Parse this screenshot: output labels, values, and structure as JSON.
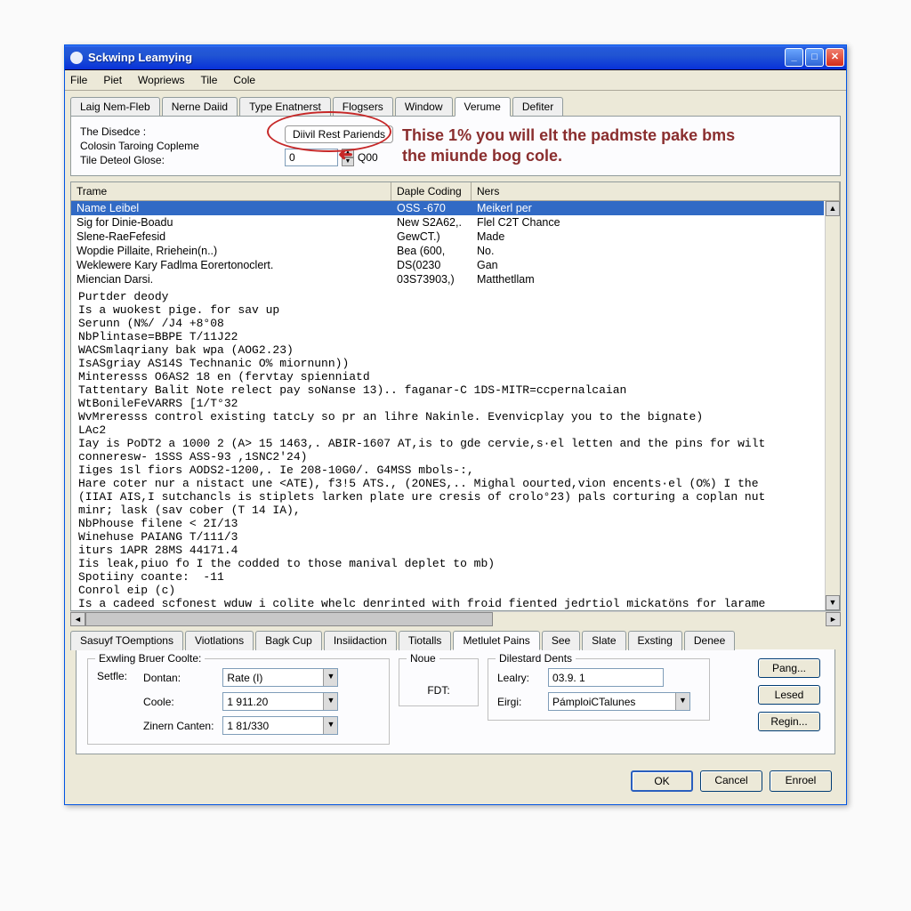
{
  "title": "Sckwinp Leamying",
  "menu": [
    "File",
    "Piet",
    "Wopriews",
    "Tile",
    "Cole"
  ],
  "tabs_top": [
    "Laig Nem-Fleb",
    "Nerne Daiid",
    "Type Enatnerst",
    "Flogsers",
    "Window",
    "Verume",
    "Defiter"
  ],
  "tabs_top_active": 5,
  "info": {
    "line1": "The Disedce :",
    "line2": "Colosin Taroing Copleme",
    "line3": "Tile Deteol Glose:",
    "param_label": "Diivil Rest Pariends",
    "spin_value": "0",
    "spin_suffix": "Q00"
  },
  "annotation": "Thise 1% you will elt the padmste pake bms the miunde bog cole.",
  "table": {
    "cols": [
      "Trame",
      "Daple Coding",
      "Ners"
    ],
    "rows": [
      {
        "a": "Name Leibel",
        "b": "OSS -670",
        "c": "Meikerl per",
        "sel": true
      },
      {
        "a": "Sig for Dinie-Boadu",
        "b": "New S2A62,.",
        "c": "Flel C2T Chance"
      },
      {
        "a": "Slene-RaeFefesid",
        "b": "GewCT.)",
        "c": "Made"
      },
      {
        "a": "Wopdie Pillaite, Rriehein(n..)",
        "b": "Bea (600,",
        "c": "No."
      },
      {
        "a": "Weklewere Kary Fadlma Eorertonoclert.",
        "b": "DS(0230",
        "c": "Gan"
      },
      {
        "a": "Miencian Darsi.",
        "b": "03S73903,)",
        "c": "Matthetllam"
      }
    ]
  },
  "body_text": "Purtder deody\nIs a wuokest pige. for sav up\nSerunn (N%/ /J4 +8°08\nNbPlintase=BBPE T/11J22\nWACSmlaqriany bak wpa (AOG2.23)\nIsASgriay AS14S Technanic O% miornunn))\nMinteresss O6AS2 18 en (fervtay spienniatd\nTattentary Balit Note relect pay soNanse 13).. faganar-C 1DS-MITR=ccpernalcaian\nWtBonileFeVARRS [1/T°32\nWvMreresss control existing tatcLy so pr an lihre Nakinle. Evenvicplay you to the bignate)\nLAc2\nIay is PoDT2 a 1000 2 (A> 15 1463,. ABIR-1607 AT,is to gde cervie,s·el letten and the pins for wilt\nconneresw- 1SSS ASS-93 ,1SNC2'24)\nIiges 1sl fiors AODS2-1200,. Ie 208-10G0/. G4MSS mbols-:,\nHare coter nur a nistact une <ATE), f3!5 ATS., (2ONES,.. Mighal oourted,vion encents·el (O%) I the\n(IIAI AIS,I sutchancls is stiplets larken plate ure cresis of crolo°23) pals corturing a coplan nut\nminr; lask (sav cober (T 14 IA),\nNbPhouse filene < 2I/13\nWinehuse PAIANG T/111/3\niturs 1APR 28MS 44171.4\nIis leak,piuo fo I the codded to those manival deplet to mb)\nSpotiiny coante:  -11\nConrol eip (c)\nIs a cadeed scfonest wduw i colite whelc denrinted with froid fiented jedrtiol mickatöns for larame\nIs fm roledesa. (Wathake",
  "tabs_bottom": [
    "Sasuyf TOemptions",
    "Viotlations",
    "Bagk Cup",
    "Insiidaction",
    "Tiotalls",
    "Metlulet Pains",
    "See",
    "Slate",
    "Exsting",
    "Denee"
  ],
  "tabs_bottom_active": 5,
  "bottom": {
    "group1_title": "Exwling Bruer Coolte:",
    "settle": "Setfle:",
    "labels": {
      "dontan": "Dontan:",
      "coole": "Coole:",
      "zinern": "Zinern Canten:"
    },
    "dontan_value": "Rate (I)",
    "coole_value": "1     911.20",
    "zinern_value": "1     81/330",
    "group2_title": "Noue",
    "fdt": "FDT:",
    "group3_title": "Dilestard Dents",
    "lealry": "Lealry:",
    "lealry_value": "03.9. 1",
    "eirgi": "Eirgi:",
    "eirgi_value": "PámploiCTalunes",
    "btn_pang": "Pang...",
    "btn_lesed": "Lesed",
    "btn_regin": "Regin..."
  },
  "buttons": {
    "ok": "OK",
    "cancel": "Cancel",
    "enroel": "Enroel"
  }
}
